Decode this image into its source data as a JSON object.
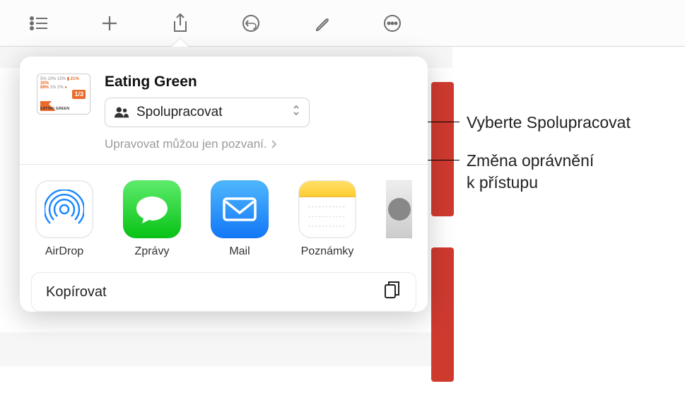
{
  "toolbar": {
    "icons": [
      "list",
      "add",
      "share",
      "undo",
      "brush",
      "more"
    ]
  },
  "document": {
    "title": "Eating Green",
    "thumb_text_top": "5% 10% 15%",
    "thumb_pct_a": "88%",
    "thumb_pct_b": "1%",
    "thumb_pct_c": "2%",
    "thumb_pct_d": "21% 30%",
    "thumb_frac": "1/3",
    "thumb_brand": "EATING GREEN"
  },
  "collab": {
    "button_label": "Spolupracovat",
    "permission_text": "Upravovat můžou jen pozvaní."
  },
  "apps": {
    "airdrop": "AirDrop",
    "messages": "Zprávy",
    "mail": "Mail",
    "notes": "Poznámky"
  },
  "actions": {
    "copy": "Kopírovat"
  },
  "callouts": {
    "collab": "Vyberte Spolupracovat",
    "perm_line1": "Změna oprávnění",
    "perm_line2": "k přístupu"
  }
}
